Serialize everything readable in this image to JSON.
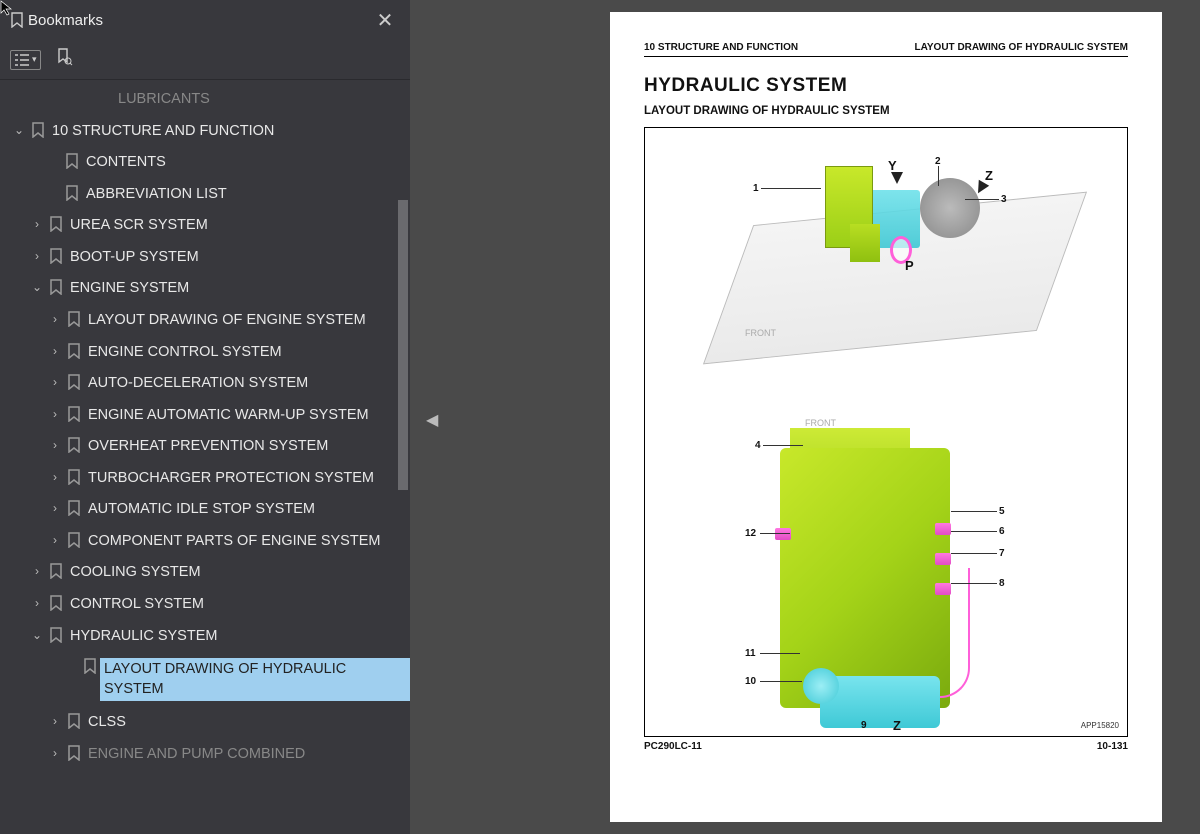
{
  "panel": {
    "title": "Bookmarks"
  },
  "tree": {
    "lubricants": "LUBRICANTS",
    "section": "10 STRUCTURE AND FUNCTION",
    "contents": "CONTENTS",
    "abbrev": "ABBREVIATION LIST",
    "urea": "UREA SCR SYSTEM",
    "bootup": "BOOT-UP SYSTEM",
    "engine": "ENGINE SYSTEM",
    "eng_layout": "LAYOUT DRAWING OF ENGINE SYSTEM",
    "eng_ctrl": "ENGINE CONTROL SYSTEM",
    "eng_autodecel": "AUTO-DECELERATION SYSTEM",
    "eng_warmup": "ENGINE AUTOMATIC WARM-UP SYSTEM",
    "eng_overheat": "OVERHEAT PREVENTION SYSTEM",
    "eng_turbo": "TURBOCHARGER PROTECTION SYSTEM",
    "eng_idle": "AUTOMATIC IDLE STOP SYSTEM",
    "eng_comp": "COMPONENT PARTS OF ENGINE SYSTEM",
    "cooling": "COOLING SYSTEM",
    "control": "CONTROL SYSTEM",
    "hydraulic": "HYDRAULIC SYSTEM",
    "hyd_layout": "LAYOUT DRAWING OF HYDRAULIC SYSTEM",
    "clss": "CLSS",
    "eng_pump": "ENGINE AND PUMP COMBINED"
  },
  "page": {
    "hl": "10 STRUCTURE AND FUNCTION",
    "hr": "LAYOUT DRAWING OF HYDRAULIC SYSTEM",
    "title": "HYDRAULIC SYSTEM",
    "subtitle": "LAYOUT DRAWING OF HYDRAULIC SYSTEM",
    "front": "FRONT",
    "labels": {
      "Y": "Y",
      "Z": "Z",
      "P": "P",
      "n1": "1",
      "n2": "2",
      "n3": "3",
      "n4": "4",
      "n5": "5",
      "n6": "6",
      "n7": "7",
      "n8": "8",
      "n9": "9",
      "n10": "10",
      "n11": "11",
      "n12": "12"
    },
    "imgcode": "APP15820",
    "fl": "PC290LC-11",
    "fr": "10-131"
  }
}
